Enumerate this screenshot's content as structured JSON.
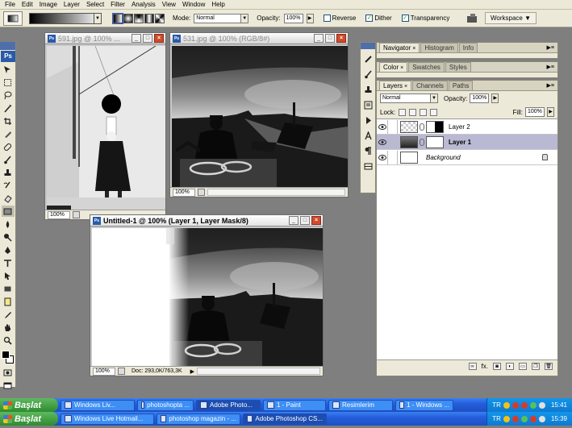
{
  "menu": [
    "File",
    "Edit",
    "Image",
    "Layer",
    "Select",
    "Filter",
    "Analysis",
    "View",
    "Window",
    "Help"
  ],
  "options": {
    "mode_label": "Mode:",
    "mode_value": "Normal",
    "opacity_label": "Opacity:",
    "opacity_value": "100%",
    "reverse_label": "Reverse",
    "dither_label": "Dither",
    "transparency_label": "Transparency",
    "workspace_label": "Workspace ▼"
  },
  "toolbox": {
    "logo": "Ps"
  },
  "documents": [
    {
      "title": "591.jpg @ 100% ...",
      "zoom": "100%",
      "info": ""
    },
    {
      "title": "531.jpg @ 100% (RGB/8#)",
      "zoom": "100%",
      "info": ""
    },
    {
      "title": "Untitled-1 @ 100% (Layer 1, Layer Mask/8)",
      "zoom": "100%",
      "info": "Doc: 293,0K/763,3K"
    }
  ],
  "panels": {
    "top": {
      "tabs": [
        "Navigator",
        "Histogram",
        "Info"
      ]
    },
    "middle": {
      "tabs": [
        "Color",
        "Swatches",
        "Styles"
      ]
    },
    "layers": {
      "tabs": [
        "Layers",
        "Channels",
        "Paths"
      ],
      "blend_mode": "Normal",
      "opacity_label": "Opacity:",
      "opacity_value": "100%",
      "lock_label": "Lock:",
      "fill_label": "Fill:",
      "fill_value": "100%",
      "rows": [
        {
          "name": "Layer 2"
        },
        {
          "name": "Layer 1"
        },
        {
          "name": "Background"
        }
      ],
      "footer_fx": "fx."
    }
  },
  "taskbar1": {
    "start": "Başlat",
    "buttons": [
      "Windows Liv...",
      "photoshopta ...",
      "Adobe Photo...",
      "1 - Paint",
      "Resimlerim",
      "1 - Windows ..."
    ],
    "lang": "TR",
    "clock": "15:41"
  },
  "taskbar2": {
    "start": "Başlat",
    "buttons": [
      "Windows Live Hotmail...",
      "photoshop magazin - ...",
      "Adobe Photoshop CS..."
    ],
    "lang": "TR",
    "clock": "15:39"
  },
  "colors": {
    "taskbar_blue": "#245edb",
    "start_green": "#2f8b2f",
    "workspace_gray": "#7f7f7f",
    "selected_layer": "#b9b9d4",
    "close_red": "#d24a2b"
  }
}
